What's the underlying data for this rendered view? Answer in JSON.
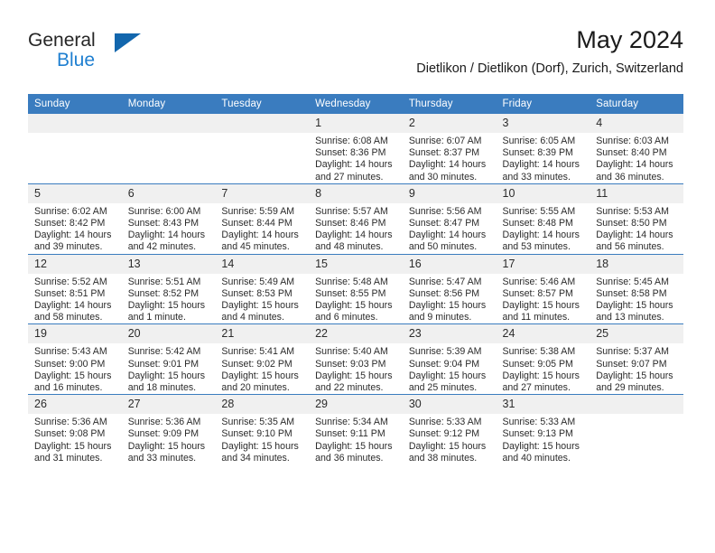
{
  "brand": {
    "word_one": "General",
    "word_two": "Blue",
    "triangle_icon": "triangle-icon"
  },
  "header": {
    "month_title": "May 2024",
    "location": "Dietlikon / Dietlikon (Dorf), Zurich, Switzerland"
  },
  "colors": {
    "header_blue": "#3a7cbf",
    "brand_blue": "#1f7fd0",
    "daynum_band": "#f0f0f0",
    "text": "#2b2b2b"
  },
  "calendar": {
    "weekday_headers": [
      "Sunday",
      "Monday",
      "Tuesday",
      "Wednesday",
      "Thursday",
      "Friday",
      "Saturday"
    ],
    "weeks": [
      [
        {
          "day": "",
          "sunrise": "",
          "sunset": "",
          "daylight_line1": "",
          "daylight_line2": ""
        },
        {
          "day": "",
          "sunrise": "",
          "sunset": "",
          "daylight_line1": "",
          "daylight_line2": ""
        },
        {
          "day": "",
          "sunrise": "",
          "sunset": "",
          "daylight_line1": "",
          "daylight_line2": ""
        },
        {
          "day": "1",
          "sunrise": "Sunrise: 6:08 AM",
          "sunset": "Sunset: 8:36 PM",
          "daylight_line1": "Daylight: 14 hours",
          "daylight_line2": "and 27 minutes."
        },
        {
          "day": "2",
          "sunrise": "Sunrise: 6:07 AM",
          "sunset": "Sunset: 8:37 PM",
          "daylight_line1": "Daylight: 14 hours",
          "daylight_line2": "and 30 minutes."
        },
        {
          "day": "3",
          "sunrise": "Sunrise: 6:05 AM",
          "sunset": "Sunset: 8:39 PM",
          "daylight_line1": "Daylight: 14 hours",
          "daylight_line2": "and 33 minutes."
        },
        {
          "day": "4",
          "sunrise": "Sunrise: 6:03 AM",
          "sunset": "Sunset: 8:40 PM",
          "daylight_line1": "Daylight: 14 hours",
          "daylight_line2": "and 36 minutes."
        }
      ],
      [
        {
          "day": "5",
          "sunrise": "Sunrise: 6:02 AM",
          "sunset": "Sunset: 8:42 PM",
          "daylight_line1": "Daylight: 14 hours",
          "daylight_line2": "and 39 minutes."
        },
        {
          "day": "6",
          "sunrise": "Sunrise: 6:00 AM",
          "sunset": "Sunset: 8:43 PM",
          "daylight_line1": "Daylight: 14 hours",
          "daylight_line2": "and 42 minutes."
        },
        {
          "day": "7",
          "sunrise": "Sunrise: 5:59 AM",
          "sunset": "Sunset: 8:44 PM",
          "daylight_line1": "Daylight: 14 hours",
          "daylight_line2": "and 45 minutes."
        },
        {
          "day": "8",
          "sunrise": "Sunrise: 5:57 AM",
          "sunset": "Sunset: 8:46 PM",
          "daylight_line1": "Daylight: 14 hours",
          "daylight_line2": "and 48 minutes."
        },
        {
          "day": "9",
          "sunrise": "Sunrise: 5:56 AM",
          "sunset": "Sunset: 8:47 PM",
          "daylight_line1": "Daylight: 14 hours",
          "daylight_line2": "and 50 minutes."
        },
        {
          "day": "10",
          "sunrise": "Sunrise: 5:55 AM",
          "sunset": "Sunset: 8:48 PM",
          "daylight_line1": "Daylight: 14 hours",
          "daylight_line2": "and 53 minutes."
        },
        {
          "day": "11",
          "sunrise": "Sunrise: 5:53 AM",
          "sunset": "Sunset: 8:50 PM",
          "daylight_line1": "Daylight: 14 hours",
          "daylight_line2": "and 56 minutes."
        }
      ],
      [
        {
          "day": "12",
          "sunrise": "Sunrise: 5:52 AM",
          "sunset": "Sunset: 8:51 PM",
          "daylight_line1": "Daylight: 14 hours",
          "daylight_line2": "and 58 minutes."
        },
        {
          "day": "13",
          "sunrise": "Sunrise: 5:51 AM",
          "sunset": "Sunset: 8:52 PM",
          "daylight_line1": "Daylight: 15 hours",
          "daylight_line2": "and 1 minute."
        },
        {
          "day": "14",
          "sunrise": "Sunrise: 5:49 AM",
          "sunset": "Sunset: 8:53 PM",
          "daylight_line1": "Daylight: 15 hours",
          "daylight_line2": "and 4 minutes."
        },
        {
          "day": "15",
          "sunrise": "Sunrise: 5:48 AM",
          "sunset": "Sunset: 8:55 PM",
          "daylight_line1": "Daylight: 15 hours",
          "daylight_line2": "and 6 minutes."
        },
        {
          "day": "16",
          "sunrise": "Sunrise: 5:47 AM",
          "sunset": "Sunset: 8:56 PM",
          "daylight_line1": "Daylight: 15 hours",
          "daylight_line2": "and 9 minutes."
        },
        {
          "day": "17",
          "sunrise": "Sunrise: 5:46 AM",
          "sunset": "Sunset: 8:57 PM",
          "daylight_line1": "Daylight: 15 hours",
          "daylight_line2": "and 11 minutes."
        },
        {
          "day": "18",
          "sunrise": "Sunrise: 5:45 AM",
          "sunset": "Sunset: 8:58 PM",
          "daylight_line1": "Daylight: 15 hours",
          "daylight_line2": "and 13 minutes."
        }
      ],
      [
        {
          "day": "19",
          "sunrise": "Sunrise: 5:43 AM",
          "sunset": "Sunset: 9:00 PM",
          "daylight_line1": "Daylight: 15 hours",
          "daylight_line2": "and 16 minutes."
        },
        {
          "day": "20",
          "sunrise": "Sunrise: 5:42 AM",
          "sunset": "Sunset: 9:01 PM",
          "daylight_line1": "Daylight: 15 hours",
          "daylight_line2": "and 18 minutes."
        },
        {
          "day": "21",
          "sunrise": "Sunrise: 5:41 AM",
          "sunset": "Sunset: 9:02 PM",
          "daylight_line1": "Daylight: 15 hours",
          "daylight_line2": "and 20 minutes."
        },
        {
          "day": "22",
          "sunrise": "Sunrise: 5:40 AM",
          "sunset": "Sunset: 9:03 PM",
          "daylight_line1": "Daylight: 15 hours",
          "daylight_line2": "and 22 minutes."
        },
        {
          "day": "23",
          "sunrise": "Sunrise: 5:39 AM",
          "sunset": "Sunset: 9:04 PM",
          "daylight_line1": "Daylight: 15 hours",
          "daylight_line2": "and 25 minutes."
        },
        {
          "day": "24",
          "sunrise": "Sunrise: 5:38 AM",
          "sunset": "Sunset: 9:05 PM",
          "daylight_line1": "Daylight: 15 hours",
          "daylight_line2": "and 27 minutes."
        },
        {
          "day": "25",
          "sunrise": "Sunrise: 5:37 AM",
          "sunset": "Sunset: 9:07 PM",
          "daylight_line1": "Daylight: 15 hours",
          "daylight_line2": "and 29 minutes."
        }
      ],
      [
        {
          "day": "26",
          "sunrise": "Sunrise: 5:36 AM",
          "sunset": "Sunset: 9:08 PM",
          "daylight_line1": "Daylight: 15 hours",
          "daylight_line2": "and 31 minutes."
        },
        {
          "day": "27",
          "sunrise": "Sunrise: 5:36 AM",
          "sunset": "Sunset: 9:09 PM",
          "daylight_line1": "Daylight: 15 hours",
          "daylight_line2": "and 33 minutes."
        },
        {
          "day": "28",
          "sunrise": "Sunrise: 5:35 AM",
          "sunset": "Sunset: 9:10 PM",
          "daylight_line1": "Daylight: 15 hours",
          "daylight_line2": "and 34 minutes."
        },
        {
          "day": "29",
          "sunrise": "Sunrise: 5:34 AM",
          "sunset": "Sunset: 9:11 PM",
          "daylight_line1": "Daylight: 15 hours",
          "daylight_line2": "and 36 minutes."
        },
        {
          "day": "30",
          "sunrise": "Sunrise: 5:33 AM",
          "sunset": "Sunset: 9:12 PM",
          "daylight_line1": "Daylight: 15 hours",
          "daylight_line2": "and 38 minutes."
        },
        {
          "day": "31",
          "sunrise": "Sunrise: 5:33 AM",
          "sunset": "Sunset: 9:13 PM",
          "daylight_line1": "Daylight: 15 hours",
          "daylight_line2": "and 40 minutes."
        },
        {
          "day": "",
          "sunrise": "",
          "sunset": "",
          "daylight_line1": "",
          "daylight_line2": ""
        }
      ]
    ]
  }
}
